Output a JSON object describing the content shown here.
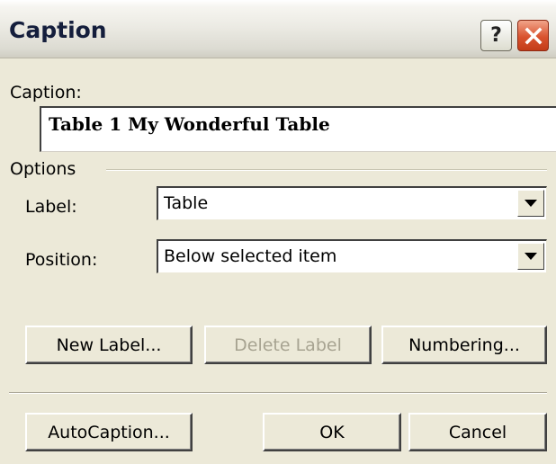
{
  "window": {
    "title": "Caption",
    "help_icon": "help-icon",
    "close_icon": "close-icon"
  },
  "caption": {
    "label": "Caption:",
    "value": "Table 1 My Wonderful Table"
  },
  "options": {
    "group_label": "Options",
    "label_field": {
      "label": "Label:",
      "value": "Table"
    },
    "position_field": {
      "label": "Position:",
      "value": "Below selected item"
    }
  },
  "buttons": {
    "new_label": "New Label...",
    "delete_label": "Delete Label",
    "numbering": "Numbering...",
    "autocaption": "AutoCaption...",
    "ok": "OK",
    "cancel": "Cancel"
  },
  "colors": {
    "dialog_bg": "#ece9d8",
    "close_button": "#d9532f"
  }
}
